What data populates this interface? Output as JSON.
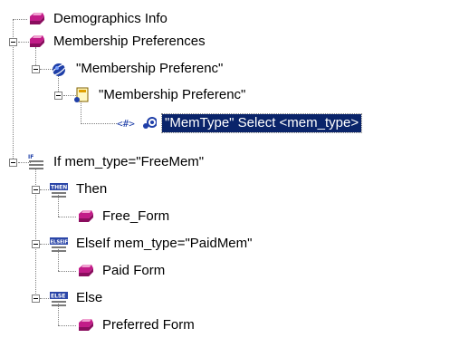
{
  "tree": {
    "nodes": [
      {
        "label": "Demographics Info",
        "icon": "gem-icon"
      },
      {
        "label": "Membership Preferences",
        "icon": "gem-icon"
      },
      {
        "label": "\"Membership Preferenc\"",
        "icon": "globe-satellite-icon"
      },
      {
        "label": "\"Membership Preferenc\"",
        "icon": "page-icon"
      },
      {
        "label": "\"MemType\" Select <mem_type>",
        "icon": "variable-icon",
        "selected": true
      },
      {
        "label": "If mem_type=\"FreeMem\"",
        "icon": "if-icon"
      },
      {
        "label": "Then",
        "icon": "then-icon",
        "keyword": "THEN"
      },
      {
        "label": "Free_Form",
        "icon": "gem-icon"
      },
      {
        "label": "ElseIf mem_type=\"PaidMem\"",
        "icon": "elseif-icon",
        "keyword": "ELSEIF"
      },
      {
        "label": "Paid Form",
        "icon": "gem-icon"
      },
      {
        "label": "Else",
        "icon": "else-icon",
        "keyword": "ELSE"
      },
      {
        "label": "Preferred Form",
        "icon": "gem-icon"
      }
    ],
    "colors": {
      "selection_background": "#0a246a",
      "selection_text": "#ffffff",
      "gem": "#b0187a",
      "keyword_box": "#2b46a8"
    }
  }
}
